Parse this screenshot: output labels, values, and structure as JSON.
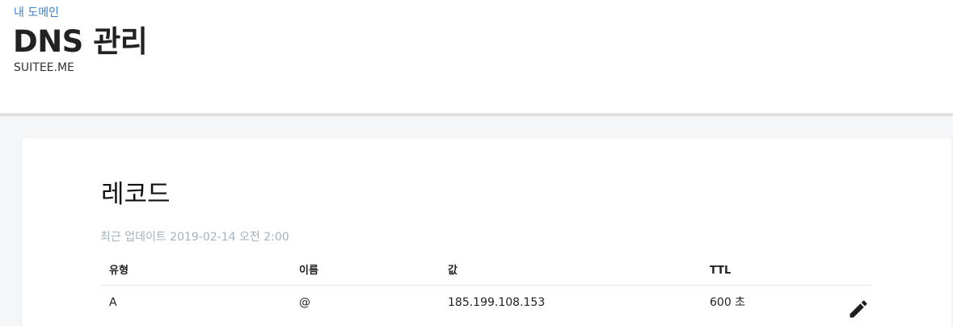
{
  "header": {
    "breadcrumb": "내 도메인",
    "title": "DNS 관리",
    "domain": "SUITEE.ME"
  },
  "records": {
    "title": "레코드",
    "updated": "최근 업데이트 2019-02-14 오전 2:00",
    "columns": {
      "type": "유형",
      "name": "이름",
      "value": "값",
      "ttl": "TTL"
    },
    "rows": [
      {
        "type": "A",
        "name": "@",
        "value": "185.199.108.153",
        "ttl": "600 초",
        "action_icon": "pencil-icon"
      }
    ]
  },
  "colors": {
    "link": "#3d7fc9",
    "muted": "#a5b2bd",
    "page_background": "#f5f6f7"
  }
}
